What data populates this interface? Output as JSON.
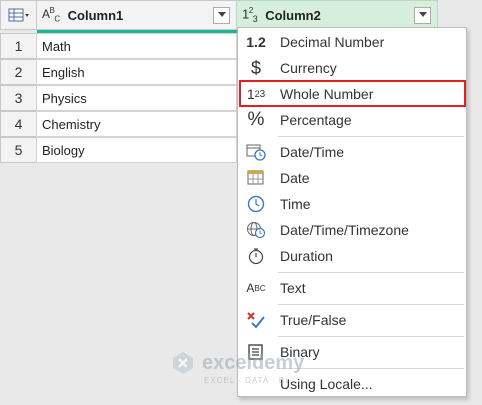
{
  "table": {
    "columns": [
      {
        "type_badge": "ABC",
        "title": "Column1"
      },
      {
        "type_badge": "123",
        "title": "Column2"
      }
    ],
    "rows": [
      {
        "num": "1",
        "value": "Math"
      },
      {
        "num": "2",
        "value": "English"
      },
      {
        "num": "3",
        "value": "Physics"
      },
      {
        "num": "4",
        "value": "Chemistry"
      },
      {
        "num": "5",
        "value": "Biology"
      }
    ]
  },
  "type_menu": {
    "items": [
      {
        "label": "Decimal Number",
        "icon": "decimal-icon",
        "glyph": "1.2"
      },
      {
        "label": "Currency",
        "icon": "currency-icon",
        "glyph": "$"
      },
      {
        "label": "Whole Number",
        "icon": "whole-number-icon",
        "glyph": "123",
        "highlighted": true
      },
      {
        "label": "Percentage",
        "icon": "percentage-icon",
        "glyph": "%"
      },
      {
        "label": "Date/Time",
        "icon": "datetime-icon"
      },
      {
        "label": "Date",
        "icon": "date-icon"
      },
      {
        "label": "Time",
        "icon": "time-icon"
      },
      {
        "label": "Date/Time/Timezone",
        "icon": "timezone-icon"
      },
      {
        "label": "Duration",
        "icon": "duration-icon"
      },
      {
        "label": "Text",
        "icon": "text-icon",
        "glyph": "ABC"
      },
      {
        "label": "True/False",
        "icon": "true-false-icon"
      },
      {
        "label": "Binary",
        "icon": "binary-icon"
      },
      {
        "label": "Using Locale...",
        "icon": "locale-icon"
      }
    ]
  },
  "watermark": {
    "name": "exceldemy",
    "tagline": "EXCEL · DATA · BI"
  },
  "colors": {
    "accent": "#19b59a",
    "highlight_border": "#e02020",
    "column2_header": "#d6efdd"
  }
}
